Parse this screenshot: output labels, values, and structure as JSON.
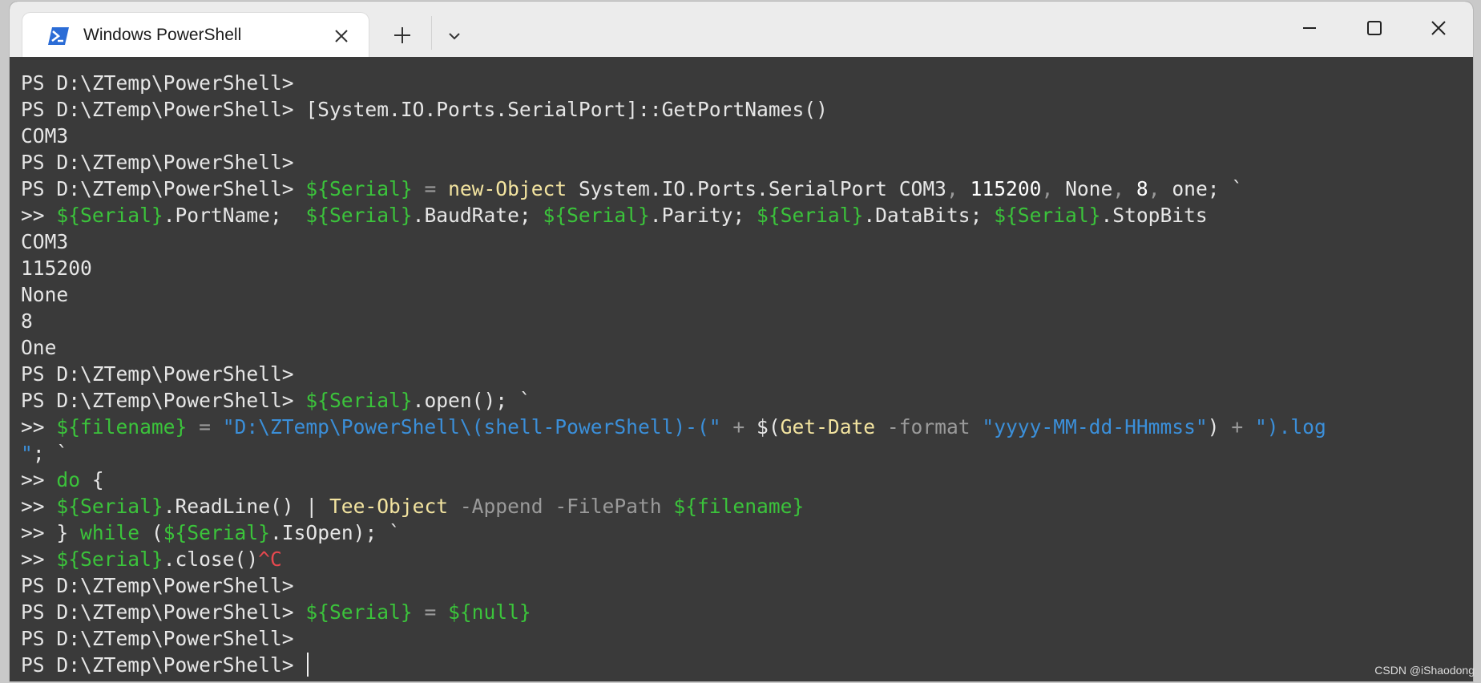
{
  "window": {
    "tab_title": "Windows PowerShell",
    "tab_icon": "powershell-icon",
    "new_tab_icon": "plus-icon",
    "dropdown_icon": "chevron-down-icon",
    "controls": [
      "minimize-icon",
      "maximize-icon",
      "close-icon"
    ]
  },
  "colors": {
    "terminal_bg": "#3a3a3a",
    "text": "#e6e6e6",
    "variable": "#3bc33b",
    "command": "#f3e4a0",
    "string": "#3b8fd9",
    "number": "#ffffff",
    "operator": "#9a9a9a",
    "error": "#e8484f"
  },
  "terminal": {
    "lines": [
      [
        [
          "prompt",
          "PS D:\\ZTemp\\PowerShell> "
        ]
      ],
      [
        [
          "prompt",
          "PS D:\\ZTemp\\PowerShell> "
        ],
        [
          "plain",
          "[System.IO.Ports.SerialPort]::GetPortNames()"
        ]
      ],
      [
        [
          "plain",
          "COM3"
        ]
      ],
      [
        [
          "prompt",
          "PS D:\\ZTemp\\PowerShell> "
        ]
      ],
      [
        [
          "prompt",
          "PS D:\\ZTemp\\PowerShell> "
        ],
        [
          "var",
          "${Serial}"
        ],
        [
          "op",
          " = "
        ],
        [
          "cmd",
          "new-Object"
        ],
        [
          "plain",
          " System.IO.Ports.SerialPort COM3"
        ],
        [
          "op",
          ", "
        ],
        [
          "num",
          "115200"
        ],
        [
          "op",
          ", "
        ],
        [
          "plain",
          "None"
        ],
        [
          "op",
          ", "
        ],
        [
          "num",
          "8"
        ],
        [
          "op",
          ", "
        ],
        [
          "plain",
          "one; `"
        ]
      ],
      [
        [
          "prompt",
          ">> "
        ],
        [
          "var",
          "${Serial}"
        ],
        [
          "plain",
          ".PortName;  "
        ],
        [
          "var",
          "${Serial}"
        ],
        [
          "plain",
          ".BaudRate; "
        ],
        [
          "var",
          "${Serial}"
        ],
        [
          "plain",
          ".Parity; "
        ],
        [
          "var",
          "${Serial}"
        ],
        [
          "plain",
          ".DataBits; "
        ],
        [
          "var",
          "${Serial}"
        ],
        [
          "plain",
          ".StopBits"
        ]
      ],
      [
        [
          "plain",
          "COM3"
        ]
      ],
      [
        [
          "plain",
          "115200"
        ]
      ],
      [
        [
          "plain",
          "None"
        ]
      ],
      [
        [
          "plain",
          "8"
        ]
      ],
      [
        [
          "plain",
          "One"
        ]
      ],
      [
        [
          "prompt",
          "PS D:\\ZTemp\\PowerShell> "
        ]
      ],
      [
        [
          "prompt",
          "PS D:\\ZTemp\\PowerShell> "
        ],
        [
          "var",
          "${Serial}"
        ],
        [
          "plain",
          ".open(); `"
        ]
      ],
      [
        [
          "prompt",
          ">> "
        ],
        [
          "var",
          "${filename}"
        ],
        [
          "op",
          " = "
        ],
        [
          "str",
          "\"D:\\ZTemp\\PowerShell\\(shell-PowerShell)-(\""
        ],
        [
          "op",
          " + "
        ],
        [
          "plain",
          "$("
        ],
        [
          "cmd",
          "Get-Date"
        ],
        [
          "param",
          " -format "
        ],
        [
          "str",
          "\"yyyy-MM-dd-HHmmss\""
        ],
        [
          "plain",
          ")"
        ],
        [
          "op",
          " + "
        ],
        [
          "str",
          "\").log"
        ]
      ],
      [
        [
          "str",
          "\""
        ],
        [
          "plain",
          "; `"
        ]
      ],
      [
        [
          "prompt",
          ">> "
        ],
        [
          "kw",
          "do"
        ],
        [
          "plain",
          " {"
        ]
      ],
      [
        [
          "prompt",
          ">> "
        ],
        [
          "var",
          "${Serial}"
        ],
        [
          "plain",
          ".ReadLine() | "
        ],
        [
          "cmd",
          "Tee-Object"
        ],
        [
          "param",
          " -Append -FilePath "
        ],
        [
          "var",
          "${filename}"
        ]
      ],
      [
        [
          "prompt",
          ">> "
        ],
        [
          "plain",
          "} "
        ],
        [
          "kw",
          "while"
        ],
        [
          "plain",
          " ("
        ],
        [
          "var",
          "${Serial}"
        ],
        [
          "plain",
          ".IsOpen); `"
        ]
      ],
      [
        [
          "prompt",
          ">> "
        ],
        [
          "var",
          "${Serial}"
        ],
        [
          "plain",
          ".close()"
        ],
        [
          "err",
          "^C"
        ]
      ],
      [
        [
          "prompt",
          "PS D:\\ZTemp\\PowerShell> "
        ]
      ],
      [
        [
          "prompt",
          "PS D:\\ZTemp\\PowerShell> "
        ],
        [
          "var",
          "${Serial}"
        ],
        [
          "op",
          " = "
        ],
        [
          "var",
          "${null}"
        ]
      ],
      [
        [
          "prompt",
          "PS D:\\ZTemp\\PowerShell> "
        ]
      ],
      [
        [
          "prompt",
          "PS D:\\ZTemp\\PowerShell> "
        ]
      ]
    ]
  },
  "watermark": "CSDN @iShaodong"
}
